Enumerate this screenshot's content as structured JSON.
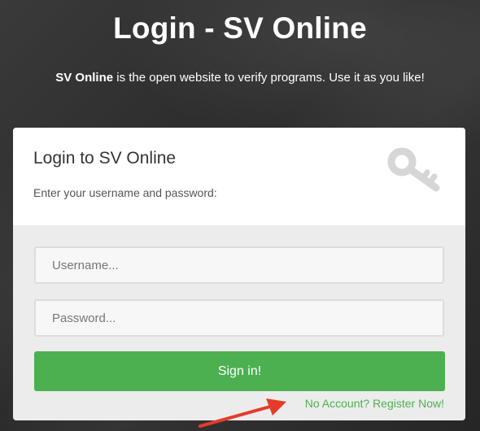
{
  "header": {
    "title": "Login - SV Online",
    "subtitle_bold": "SV Online",
    "subtitle_rest": " is the open website to verify programs. Use it as you like!"
  },
  "card": {
    "title": "Login to SV Online",
    "subtitle": "Enter your username and password:",
    "icon": "key-icon"
  },
  "form": {
    "username_placeholder": "Username...",
    "username_value": "",
    "password_placeholder": "Password...",
    "password_value": "",
    "signin_label": "Sign in!",
    "register_link": "No Account? Register Now!"
  },
  "annotation": {
    "icon": "red-arrow-icon",
    "color": "#e53b2c"
  },
  "colors": {
    "accent": "#4caf50",
    "background": "#2e2e2e"
  }
}
